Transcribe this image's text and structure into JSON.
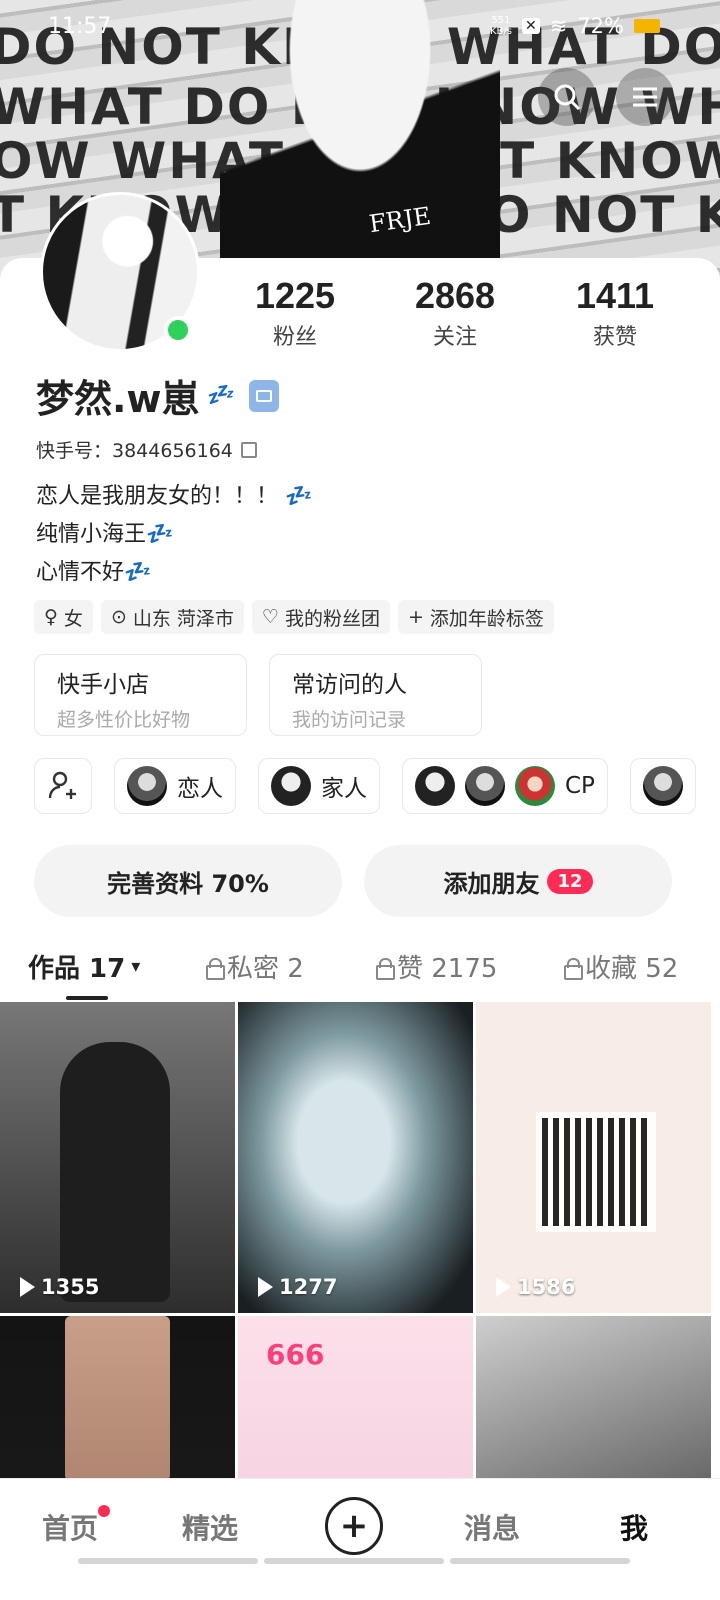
{
  "status": {
    "time": "11:57",
    "net_speed": "551",
    "net_unit": "KB/s",
    "battery": "72%"
  },
  "banner": {
    "lines": [
      "DO NOT KNOW WHAT DO NOT KNOW",
      "WHAT DO NOT KNOW WHAT DO",
      "OW WHAT DO NOT KNOW WHAT DO",
      "T KNOW WHAT DO NOT KNOW WHAT"
    ],
    "hand_text": "FRJE"
  },
  "stats": [
    {
      "value": "1225",
      "label": "粉丝"
    },
    {
      "value": "2868",
      "label": "关注"
    },
    {
      "value": "1411",
      "label": "获赞"
    }
  ],
  "profile": {
    "name": "梦然.w崽",
    "zzz": "💤",
    "id": "快手号：3844656164",
    "bio": [
      "恋人是我朋友女的！！！ 💤",
      "纯情小海王💤",
      "心情不好💤"
    ]
  },
  "tags": [
    {
      "icon": "♀",
      "label": "女"
    },
    {
      "icon": "⊙",
      "label": "山东 菏泽市"
    },
    {
      "icon": "♡",
      "label": "我的粉丝团"
    },
    {
      "icon": "+",
      "label": "添加年龄标签"
    }
  ],
  "shortcuts": [
    {
      "title": "快手小店",
      "sub": "超多性价比好物"
    },
    {
      "title": "常访问的人",
      "sub": "我的访问记录"
    }
  ],
  "relations": [
    "恋人",
    "家人",
    "CP"
  ],
  "actions": {
    "complete": "完善资料 70%",
    "add_friend": "添加朋友",
    "friend_count": "12"
  },
  "tabs": [
    {
      "label": "作品 17",
      "suffix": "▾"
    },
    {
      "label": "私密 2"
    },
    {
      "label": "赞 2175"
    },
    {
      "label": "收藏 52"
    }
  ],
  "videos": [
    {
      "plays": "1355"
    },
    {
      "plays": "1277"
    },
    {
      "plays": "1586"
    },
    {
      "plays": ""
    },
    {
      "plays": "",
      "score": "666"
    },
    {
      "plays": ""
    }
  ],
  "nav": {
    "home": "首页",
    "featured": "精选",
    "create": "+",
    "messages": "消息",
    "me": "我"
  }
}
